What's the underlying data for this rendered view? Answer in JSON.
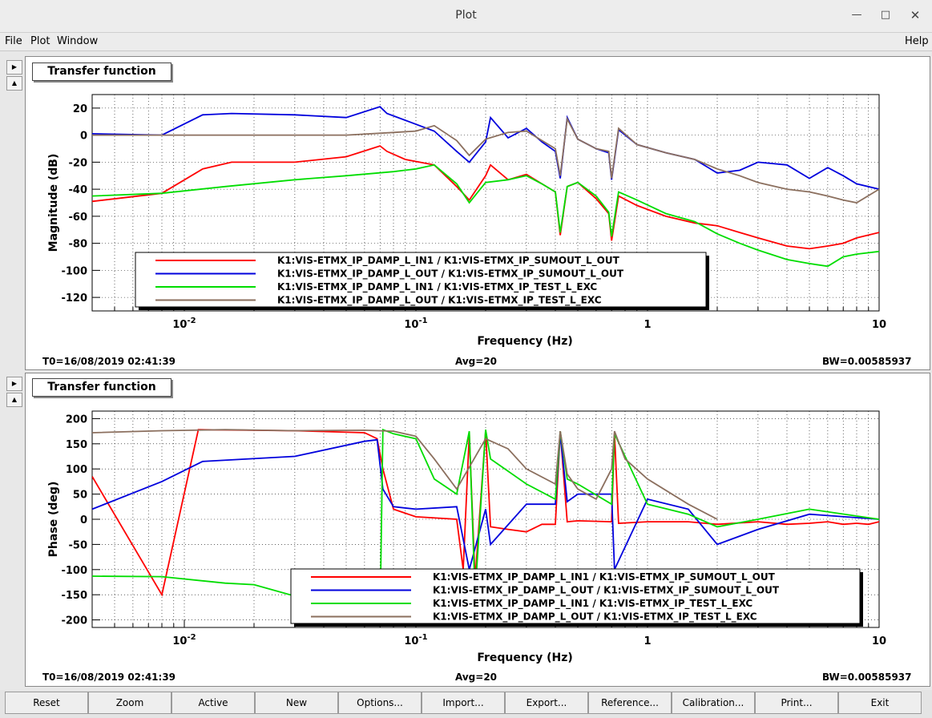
{
  "window": {
    "title": "Plot"
  },
  "menu": {
    "file": "File",
    "plot": "Plot",
    "window": "Window",
    "help": "Help"
  },
  "legend": [
    {
      "name": "K1:VIS-ETMX_IP_DAMP_L_IN1 / K1:VIS-ETMX_IP_SUMOUT_L_OUT",
      "color": "#ff0000"
    },
    {
      "name": "K1:VIS-ETMX_IP_DAMP_L_OUT / K1:VIS-ETMX_IP_SUMOUT_L_OUT",
      "color": "#0000dd"
    },
    {
      "name": "K1:VIS-ETMX_IP_DAMP_L_IN1 / K1:VIS-ETMX_IP_TEST_L_EXC",
      "color": "#00dd00"
    },
    {
      "name": "K1:VIS-ETMX_IP_DAMP_L_OUT / K1:VIS-ETMX_IP_TEST_L_EXC",
      "color": "#8b6f5e"
    }
  ],
  "panels": [
    {
      "title": "Transfer function",
      "t0": "T0=16/08/2019 02:41:39",
      "avg": "Avg=20",
      "bw": "BW=0.00585937"
    },
    {
      "title": "Transfer function",
      "t0": "T0=16/08/2019 02:41:39",
      "avg": "Avg=20",
      "bw": "BW=0.00585937"
    }
  ],
  "buttons": {
    "reset": "Reset",
    "zoom": "Zoom",
    "active": "Active",
    "new": "New",
    "options": "Options...",
    "import": "Import...",
    "export": "Export...",
    "reference": "Reference...",
    "calibration": "Calibration...",
    "print": "Print...",
    "exit": "Exit"
  },
  "chart_data": [
    {
      "type": "line",
      "title": "Transfer function",
      "xlabel": "Frequency (Hz)",
      "ylabel": "Magnitude (dB)",
      "xscale": "log",
      "xlim": [
        0.004,
        10
      ],
      "ylim": [
        -130,
        30
      ],
      "xtick_labels": [
        "10^-2",
        "10^-1",
        "1",
        "10"
      ],
      "ytick_labels": [
        "20",
        "0",
        "-20",
        "-40",
        "-60",
        "-80",
        "-100",
        "-120"
      ],
      "grid": true,
      "legend_position": "bottom-center",
      "series": [
        {
          "name": "K1:VIS-ETMX_IP_DAMP_L_IN1 / K1:VIS-ETMX_IP_SUMOUT_L_OUT",
          "color": "#ff0000",
          "x": [
            0.004,
            0.008,
            0.012,
            0.016,
            0.03,
            0.05,
            0.07,
            0.075,
            0.09,
            0.12,
            0.15,
            0.17,
            0.2,
            0.21,
            0.25,
            0.3,
            0.35,
            0.4,
            0.42,
            0.45,
            0.5,
            0.6,
            0.68,
            0.7,
            0.75,
            0.9,
            1.2,
            1.6,
            2,
            2.5,
            3,
            4,
            5,
            6,
            7,
            8,
            10
          ],
          "y": [
            -49,
            -43,
            -25,
            -20,
            -20,
            -16,
            -8,
            -12,
            -18,
            -22,
            -38,
            -48,
            -30,
            -22,
            -33,
            -29,
            -36,
            -42,
            -74,
            -38,
            -35,
            -47,
            -58,
            -78,
            -45,
            -52,
            -60,
            -65,
            -67,
            -72,
            -76,
            -82,
            -84,
            -82,
            -80,
            -76,
            -72
          ]
        },
        {
          "name": "K1:VIS-ETMX_IP_DAMP_L_OUT / K1:VIS-ETMX_IP_SUMOUT_L_OUT",
          "color": "#0000dd",
          "x": [
            0.004,
            0.008,
            0.012,
            0.016,
            0.03,
            0.05,
            0.07,
            0.075,
            0.09,
            0.12,
            0.15,
            0.17,
            0.2,
            0.21,
            0.25,
            0.3,
            0.35,
            0.4,
            0.42,
            0.45,
            0.5,
            0.6,
            0.68,
            0.7,
            0.75,
            0.9,
            1.2,
            1.6,
            2,
            2.5,
            3,
            4,
            5,
            6,
            7,
            8,
            10
          ],
          "y": [
            1,
            0,
            15,
            16,
            15,
            13,
            21,
            16,
            11,
            3,
            -12,
            -20,
            -5,
            13,
            -2,
            5,
            -5,
            -12,
            -32,
            13,
            -3,
            -10,
            -13,
            -33,
            4,
            -7,
            -13,
            -18,
            -28,
            -26,
            -20,
            -22,
            -32,
            -24,
            -30,
            -36,
            -40
          ]
        },
        {
          "name": "K1:VIS-ETMX_IP_DAMP_L_IN1 / K1:VIS-ETMX_IP_TEST_L_EXC",
          "color": "#00dd00",
          "x": [
            0.004,
            0.008,
            0.015,
            0.03,
            0.05,
            0.08,
            0.1,
            0.12,
            0.15,
            0.17,
            0.2,
            0.25,
            0.3,
            0.35,
            0.4,
            0.42,
            0.45,
            0.5,
            0.6,
            0.68,
            0.7,
            0.75,
            0.9,
            1.2,
            1.6,
            2,
            2.5,
            3,
            4,
            5,
            6,
            7,
            8,
            10
          ],
          "y": [
            -45,
            -43,
            -38,
            -33,
            -30,
            -27,
            -25,
            -22,
            -36,
            -50,
            -35,
            -33,
            -30,
            -36,
            -42,
            -72,
            -38,
            -35,
            -45,
            -57,
            -75,
            -42,
            -48,
            -58,
            -64,
            -73,
            -80,
            -85,
            -92,
            -95,
            -97,
            -90,
            -88,
            -86
          ]
        },
        {
          "name": "K1:VIS-ETMX_IP_DAMP_L_OUT / K1:VIS-ETMX_IP_TEST_L_EXC",
          "color": "#8b6f5e",
          "x": [
            0.004,
            0.008,
            0.015,
            0.03,
            0.05,
            0.08,
            0.1,
            0.12,
            0.15,
            0.17,
            0.2,
            0.25,
            0.3,
            0.35,
            0.4,
            0.42,
            0.45,
            0.5,
            0.6,
            0.68,
            0.7,
            0.75,
            0.9,
            1.2,
            1.6,
            2,
            2.5,
            3,
            4,
            5,
            6,
            7,
            8,
            10
          ],
          "y": [
            0,
            0,
            0,
            0,
            0,
            2,
            3,
            7,
            -4,
            -15,
            -3,
            2,
            3,
            -4,
            -10,
            -30,
            12,
            -3,
            -10,
            -12,
            -32,
            5,
            -7,
            -13,
            -18,
            -25,
            -30,
            -35,
            -40,
            -42,
            -45,
            -48,
            -50,
            -40
          ]
        }
      ]
    },
    {
      "type": "line",
      "title": "Transfer function",
      "xlabel": "Frequency (Hz)",
      "ylabel": "Phase (deg)",
      "xscale": "log",
      "xlim": [
        0.004,
        10
      ],
      "ylim": [
        -215,
        215
      ],
      "xtick_labels": [
        "10^-2",
        "10^-1",
        "1",
        "10"
      ],
      "ytick_labels": [
        "200",
        "150",
        "100",
        "50",
        "0",
        "-50",
        "-100",
        "-150",
        "-200"
      ],
      "grid": true,
      "legend_position": "bottom-right",
      "series": [
        {
          "name": "K1:VIS-ETMX_IP_DAMP_L_IN1 / K1:VIS-ETMX_IP_SUMOUT_L_OUT",
          "color": "#ff0000",
          "x": [
            0.004,
            0.008,
            0.0115,
            0.03,
            0.06,
            0.068,
            0.072,
            0.08,
            0.1,
            0.15,
            0.16,
            0.17,
            0.18,
            0.2,
            0.21,
            0.25,
            0.3,
            0.35,
            0.4,
            0.42,
            0.45,
            0.5,
            0.7,
            0.72,
            0.75,
            1,
            1.5,
            2,
            3,
            4,
            5,
            6,
            7,
            8,
            9,
            10
          ],
          "y": [
            85,
            -150,
            178,
            176,
            172,
            160,
            100,
            20,
            5,
            0,
            -100,
            170,
            -120,
            175,
            -15,
            -20,
            -25,
            -10,
            -10,
            175,
            -5,
            -3,
            -5,
            170,
            -8,
            -5,
            -5,
            -10,
            -5,
            -10,
            -8,
            -5,
            -10,
            -8,
            -10,
            -5
          ]
        },
        {
          "name": "K1:VIS-ETMX_IP_DAMP_L_OUT / K1:VIS-ETMX_IP_SUMOUT_L_OUT",
          "color": "#0000dd",
          "x": [
            0.004,
            0.008,
            0.012,
            0.03,
            0.06,
            0.068,
            0.072,
            0.08,
            0.1,
            0.15,
            0.17,
            0.2,
            0.21,
            0.3,
            0.4,
            0.42,
            0.45,
            0.5,
            0.7,
            0.72,
            1,
            1.5,
            2,
            3,
            5,
            10
          ],
          "y": [
            20,
            75,
            115,
            125,
            155,
            158,
            60,
            25,
            20,
            25,
            -100,
            20,
            -50,
            30,
            30,
            170,
            35,
            50,
            50,
            -100,
            40,
            20,
            -50,
            -20,
            10,
            0
          ]
        },
        {
          "name": "K1:VIS-ETMX_IP_DAMP_L_IN1 / K1:VIS-ETMX_IP_TEST_L_EXC",
          "color": "#00dd00",
          "x": [
            0.004,
            0.008,
            0.015,
            0.02,
            0.07,
            0.072,
            0.08,
            0.1,
            0.12,
            0.15,
            0.17,
            0.18,
            0.2,
            0.21,
            0.3,
            0.4,
            0.42,
            0.45,
            0.5,
            0.7,
            0.72,
            1,
            1.5,
            2,
            3,
            5,
            10
          ],
          "y": [
            -113,
            -114,
            -127,
            -130,
            -200,
            178,
            170,
            160,
            80,
            50,
            175,
            -150,
            178,
            120,
            70,
            40,
            175,
            80,
            70,
            30,
            170,
            30,
            10,
            -15,
            0,
            20,
            0
          ]
        },
        {
          "name": "K1:VIS-ETMX_IP_DAMP_L_OUT / K1:VIS-ETMX_IP_TEST_L_EXC",
          "color": "#8b6f5e",
          "x": [
            0.004,
            0.008,
            0.015,
            0.03,
            0.06,
            0.08,
            0.1,
            0.12,
            0.15,
            0.2,
            0.25,
            0.3,
            0.4,
            0.42,
            0.45,
            0.5,
            0.6,
            0.7,
            0.72,
            0.8,
            1,
            1.5,
            2
          ],
          "y": [
            172,
            176,
            178,
            176,
            177,
            175,
            165,
            120,
            60,
            160,
            140,
            100,
            70,
            175,
            90,
            60,
            40,
            100,
            175,
            120,
            80,
            30,
            0
          ]
        }
      ]
    }
  ]
}
